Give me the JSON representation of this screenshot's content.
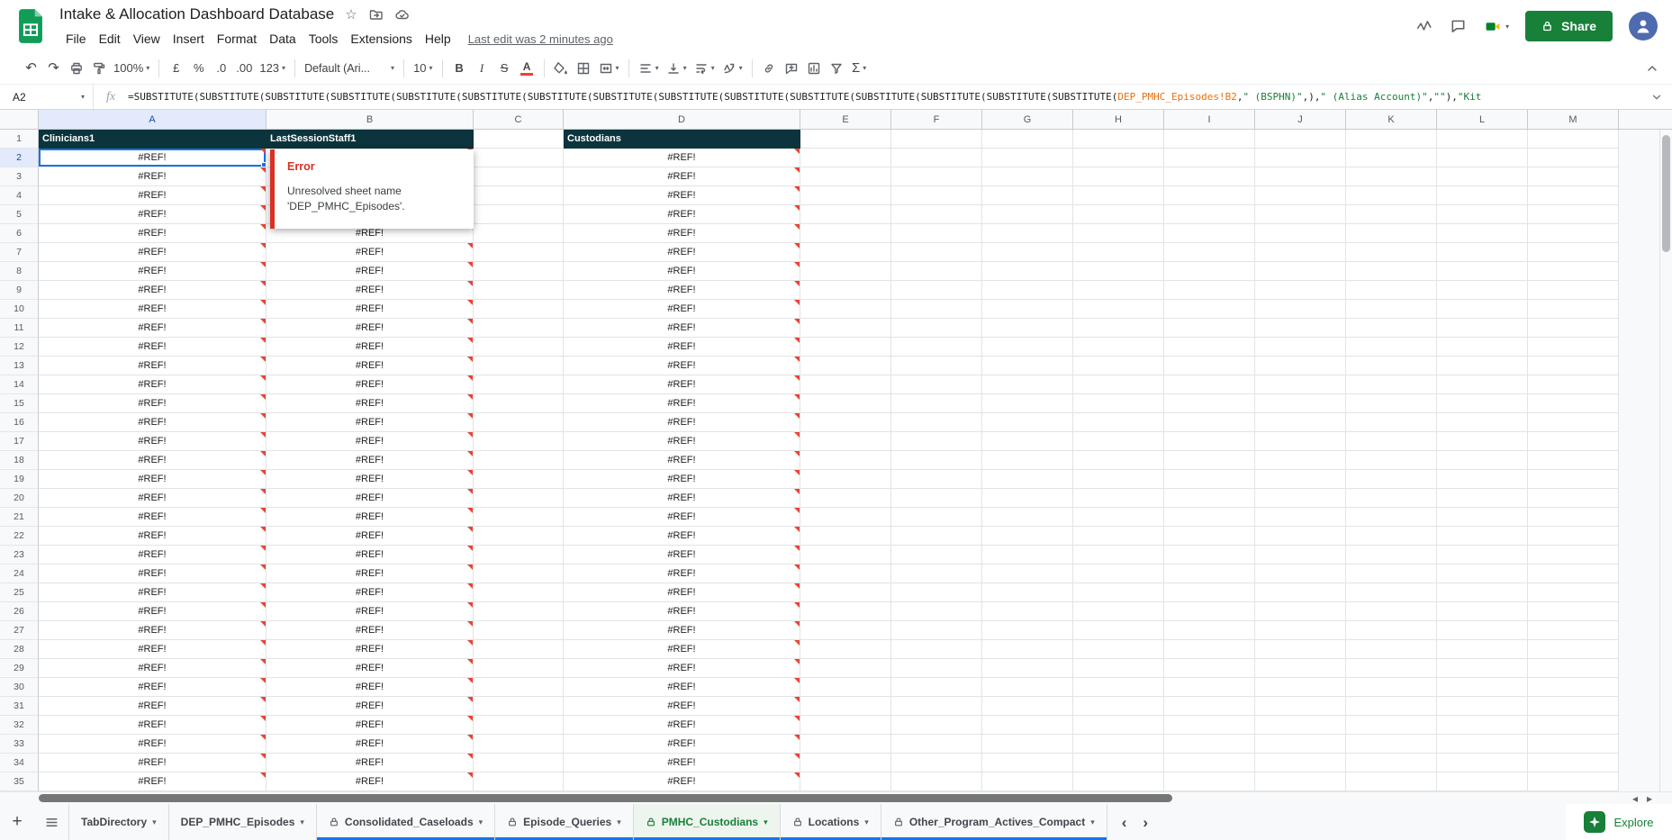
{
  "header": {
    "title": "Intake & Allocation Dashboard Database",
    "menus": [
      "File",
      "Edit",
      "View",
      "Insert",
      "Format",
      "Data",
      "Tools",
      "Extensions",
      "Help"
    ],
    "last_edit": "Last edit was 2 minutes ago",
    "share": "Share"
  },
  "icons": {
    "star": "☆",
    "undo": "↶",
    "redo": "↷",
    "caret_down": "▾",
    "plus": "+",
    "nav_left": "‹",
    "nav_right": "›",
    "hs_left": "◂",
    "hs_right": "▸"
  },
  "toolbar": {
    "zoom": "100%",
    "currency": "£",
    "percent": "%",
    "decimal_decrease": ".0",
    "decimal_increase": ".00",
    "number_format": "123",
    "font_name": "Default (Ari...",
    "font_size": "10",
    "bold": "B",
    "italic": "I",
    "strikethrough": "S",
    "text_color": "A",
    "functions": "Σ"
  },
  "formula_bar": {
    "name_box": "A2",
    "fx_label": "fx",
    "segments": [
      {
        "t": "=SUBSTITUTE(SUBSTITUTE(SUBSTITUTE(SUBSTITUTE(SUBSTITUTE(SUBSTITUTE(SUBSTITUTE(SUBSTITUTE(SUBSTITUTE(SUBSTITUTE(SUBSTITUTE(SUBSTITUTE(SUBSTITUTE(SUBSTITUTE(SUBSTITUTE(",
        "c": "#222222"
      },
      {
        "t": "DEP_PMHC_Episodes!B2",
        "c": "#e8710a"
      },
      {
        "t": ",",
        "c": "#222222"
      },
      {
        "t": "\" (BSPHN)\"",
        "c": "#188038"
      },
      {
        "t": ",),",
        "c": "#222222"
      },
      {
        "t": "\" (Alias Account)\"",
        "c": "#188038"
      },
      {
        "t": ",",
        "c": "#222222"
      },
      {
        "t": "\"\"",
        "c": "#188038"
      },
      {
        "t": "),",
        "c": "#222222"
      },
      {
        "t": "\"Kit",
        "c": "#188038"
      }
    ]
  },
  "grid": {
    "columns": [
      "A",
      "B",
      "C",
      "D",
      "E",
      "F",
      "G",
      "H",
      "I",
      "J",
      "K",
      "L",
      "M"
    ],
    "row_count": 35,
    "header_cells": {
      "A": "Clinicians1",
      "B": "LastSessionStaff1",
      "D": "Custodians"
    },
    "error_value": "#REF!",
    "error_columns": [
      "A",
      "B",
      "D"
    ],
    "selected_cell": "A2",
    "selected_column": "A",
    "selected_row": 2
  },
  "error_tooltip": {
    "title": "Error",
    "message": "Unresolved sheet name 'DEP_PMHC_Episodes'."
  },
  "tabs": {
    "items": [
      {
        "label": "TabDirectory",
        "locked": false,
        "active": false,
        "color": null
      },
      {
        "label": "DEP_PMHC_Episodes",
        "locked": false,
        "active": false,
        "color": null
      },
      {
        "label": "Consolidated_Caseloads",
        "locked": true,
        "active": false,
        "color": "#1a73e8"
      },
      {
        "label": "Episode_Queries",
        "locked": true,
        "active": false,
        "color": "#1a73e8"
      },
      {
        "label": "PMHC_Custodians",
        "locked": true,
        "active": true,
        "color": "#1a73e8"
      },
      {
        "label": "Locations",
        "locked": true,
        "active": false,
        "color": "#1a73e8"
      },
      {
        "label": "Other_Program_Actives_Compact",
        "locked": true,
        "active": false,
        "color": "#1a73e8"
      }
    ],
    "explore": "Explore"
  },
  "colors": {
    "header_cell_bg": "#0c343d",
    "error_red": "#d93025",
    "selection_blue": "#1a73e8",
    "accent_green": "#188038",
    "corner_red": "#ea4335"
  }
}
